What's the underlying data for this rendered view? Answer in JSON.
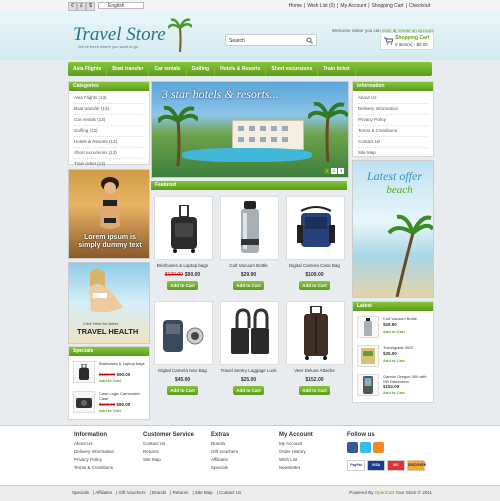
{
  "topbar": {
    "currencies": [
      "€",
      "£",
      "$"
    ],
    "language": "English",
    "links": [
      "Home",
      "Wish List (0)",
      "My Account",
      "Shopping Cart",
      "Checkout"
    ]
  },
  "header": {
    "logo": "Travel Store",
    "tagline": "We've been where you want to go",
    "welcome_prefix": "Welcome visitor you can",
    "login": "login",
    "welcome_or": "or",
    "create_account": "create an account",
    "search_placeholder": "Search",
    "cart_title": "Shopping Cart",
    "cart_summary": "0 item(s) - $0.00"
  },
  "nav": [
    "Asia Flights",
    "Boat transfer",
    "Car rentals",
    "Golfing",
    "Hotels & Resorts",
    "Short excursions",
    "Train ticket"
  ],
  "categories": {
    "title": "Categories",
    "items": [
      "Asia Flights (13)",
      "Boat transfer (13)",
      "Car rentals (13)",
      "Golfing (13)",
      "Hotels & Resorts (13)",
      "Short excursions (13)",
      "Train ticket (13)"
    ]
  },
  "information": {
    "title": "Information",
    "items": [
      "About Us",
      "Delivery Information",
      "Privacy Policy",
      "Terms & Conditions",
      "Contact Us",
      "Site Map"
    ]
  },
  "slideshow": {
    "title": "3 star hotels & resorts...",
    "pages": [
      "1",
      "2",
      "3"
    ]
  },
  "banners": {
    "lorem": "Lorem ipsum is simply dummy text",
    "click_here": "Click Here for latest",
    "travel_health": "TRAVEL HEALTH",
    "latest_offer": "Latest offer",
    "beach": "beach"
  },
  "featured": {
    "title": "Featured",
    "add_label": "Add to Cart",
    "products": [
      {
        "name": "Briefcases & Laptop bags",
        "old_price": "$120.00",
        "price": "$90.00"
      },
      {
        "name": "Colt Vacuum Bottle",
        "old_price": "",
        "price": "$29.90"
      },
      {
        "name": "Digital Camera Case Bag",
        "old_price": "",
        "price": "$109.00"
      },
      {
        "name": "Digital Camera Neo Bag",
        "old_price": "",
        "price": "$45.00"
      },
      {
        "name": "Travel Sentry Luggage Lock",
        "old_price": "",
        "price": "$25.00"
      },
      {
        "name": "Veer Deluxe Attache",
        "old_price": "",
        "price": "$152.00"
      }
    ]
  },
  "specials": {
    "title": "Specials",
    "add_label": "Add to Cart",
    "items": [
      {
        "name": "Briefcases & Laptop bags",
        "old_price": "$120.00",
        "price": "$90.00"
      },
      {
        "name": "Case Logic Camcorder Case",
        "old_price": "$200.00",
        "price": "$80.00"
      }
    ]
  },
  "latest": {
    "title": "Latest",
    "add_label": "Add to Cart",
    "items": [
      {
        "name": "Colt Vacuum Bottle",
        "price": "$29.90"
      },
      {
        "name": "Travelguide 2007",
        "price": "$25.00"
      },
      {
        "name": "Garmin Oregon 300 with GB Discoverer",
        "price": "$152.00"
      }
    ]
  },
  "footer": {
    "columns": [
      {
        "title": "Information",
        "links": [
          "About Us",
          "Delivery Information",
          "Privacy Policy",
          "Terms & Conditions"
        ]
      },
      {
        "title": "Customer Service",
        "links": [
          "Contact Us",
          "Returns",
          "Site Map"
        ]
      },
      {
        "title": "Extras",
        "links": [
          "Brands",
          "Gift Vouchers",
          "Affiliates",
          "Specials"
        ]
      },
      {
        "title": "My Account",
        "links": [
          "My Account",
          "Order History",
          "Wish List",
          "Newsletter"
        ]
      }
    ],
    "follow_title": "Follow us",
    "payments": [
      "PayPal",
      "VISA",
      "MC",
      "DISCOVER"
    ],
    "bottom_links": [
      "Specials",
      "Affiliates",
      "Gift Vouchers",
      "Brands",
      "Returns",
      "Site Map",
      "Contact Us"
    ],
    "powered_prefix": "Powered By",
    "powered_brand": "OpenCart",
    "powered_suffix": "Your Store © 2011"
  },
  "colors": {
    "accent_green": "#5d9a1c",
    "header_bg": "#d3ebf0",
    "price_old": "#cc0000"
  }
}
